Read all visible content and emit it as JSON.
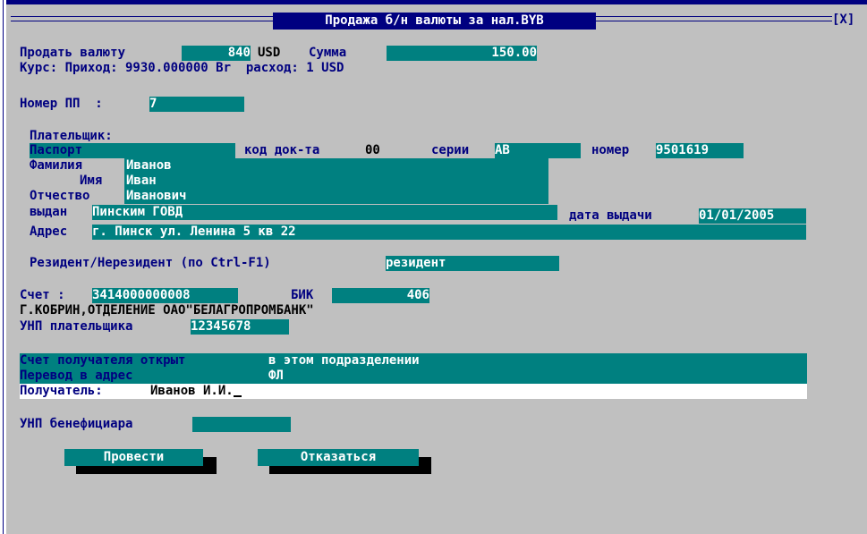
{
  "window": {
    "title": "Продажа б/н валюты за нал.BYB",
    "close": "[X]"
  },
  "sell": {
    "label": "Продать валюту",
    "code": "840",
    "currency": "USD",
    "amount_label": "Сумма",
    "amount": "150.00"
  },
  "rate": {
    "text": "Курс: Приход: 9930.000000 Br  расход: 1 USD"
  },
  "pp": {
    "label": "Номер ПП  :",
    "value": "7"
  },
  "payer": {
    "header": "Плательщик:",
    "doc_type": "Паспорт",
    "doc_code_label": "код док-та",
    "doc_code": "00",
    "series_label": "серии",
    "series": "АВ",
    "number_label": "номер",
    "number": "9501619",
    "surname_label": "Фамилия",
    "surname": "Иванов",
    "name_label": "Имя",
    "name": "Иван",
    "patronymic_label": "Отчество",
    "patronymic": "Иванович",
    "issued_label": "выдан",
    "issued": "Пинским ГОВД",
    "issue_date_label": "дата выдачи",
    "issue_date": "01/01/2005",
    "address_label": "Адрес",
    "address": "г. Пинск ул. Ленина 5 кв 22"
  },
  "resident": {
    "label": "Резидент/Нерезидент (по Ctrl-F1)",
    "value": "резидент"
  },
  "account": {
    "label": "Счет :",
    "value": "3414000000008",
    "bik_label": "БИК",
    "bik": "406",
    "bank": "Г.КОБРИН,ОТДЕЛЕНИЕ ОАО\"БЕЛАГРОПРОМБАНК\"",
    "unp_label": "УНП плательщика",
    "unp": "12345678"
  },
  "recipient": {
    "account_label": "Счет получателя открыт",
    "account_value": "в этом подразделении",
    "transfer_label": "Перевод в адрес",
    "transfer_value": "ФЛ",
    "name_label": "Получатель:",
    "name": "Иванов И.И."
  },
  "beneficiary": {
    "unp_label": "УНП бенефициара",
    "unp": ""
  },
  "buttons": {
    "submit": "Провести",
    "cancel": "Отказаться"
  }
}
